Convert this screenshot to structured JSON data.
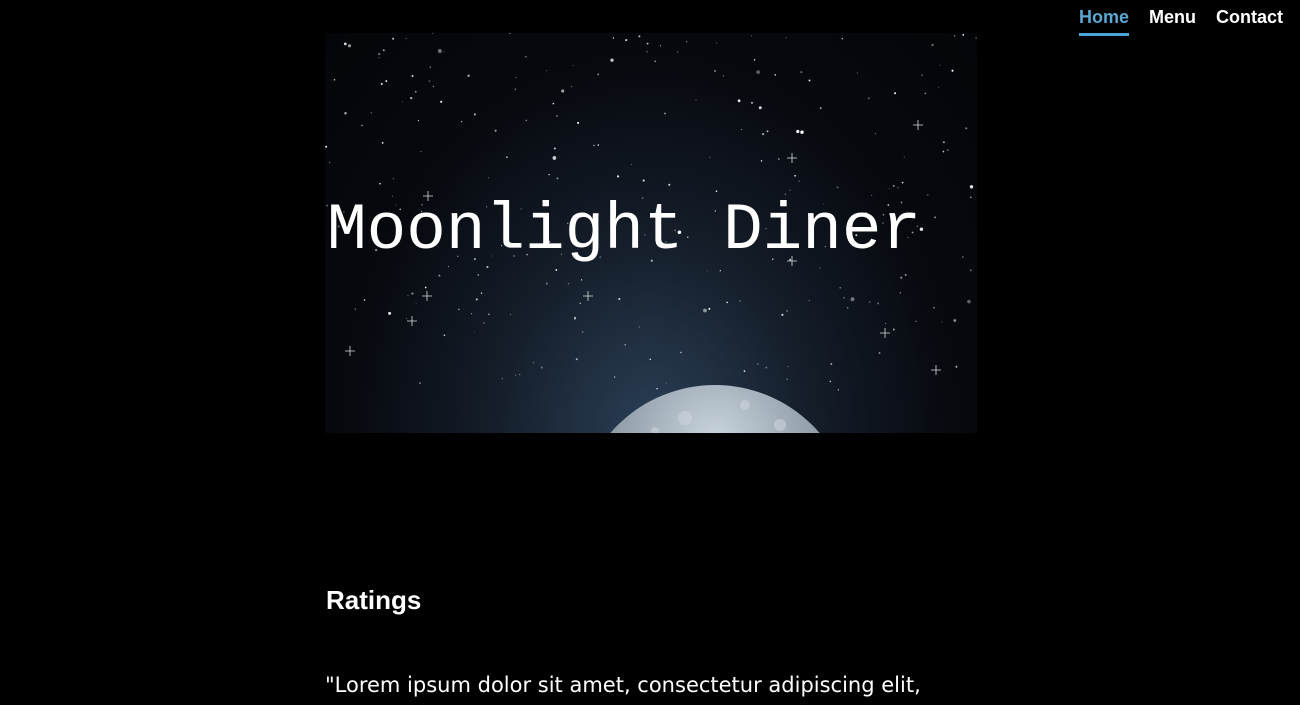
{
  "nav": {
    "items": [
      {
        "label": "Home",
        "active": true
      },
      {
        "label": "Menu",
        "active": false
      },
      {
        "label": "Contact",
        "active": false
      }
    ],
    "active_color": "#5aa7d1"
  },
  "hero": {
    "title": "Moonlight Diner",
    "image": "starry-sky-moon"
  },
  "ratings": {
    "heading": "Ratings",
    "review_text": "\"Lorem ipsum dolor sit amet, consectetur adipiscing elit,"
  }
}
